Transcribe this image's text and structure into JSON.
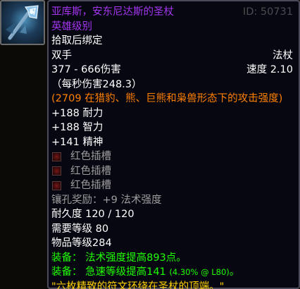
{
  "item": {
    "name": "亚库斯，安东尼达斯的圣杖",
    "id_label": "ID: 50731",
    "quality": "英雄级别",
    "binding": "拾取后绑定",
    "hand": "双手",
    "type": "法杖",
    "damage": "377 - 666伤害",
    "speed": "速度 2.10",
    "dps": "（每秒伤害248.3）",
    "feral_ap": "(2709 在猎豹、熊、巨熊和枭兽形态下的攻击强度)",
    "stats": [
      "+188 耐力",
      "+188 智力",
      "+141 精神"
    ],
    "sockets": [
      "红色插槽",
      "红色插槽",
      "红色插槽"
    ],
    "socket_bonus": "镶孔奖励：+9 法术强度",
    "durability": "耐久度 120 / 120",
    "required_level": "需要等级 80",
    "item_level": "物品等级284",
    "equip_1": "装备： 法术强度提高893点。",
    "equip_2_main": "装备： 急速等级提高141",
    "equip_2_detail": "(4.30% @ L80)",
    "equip_2_tail": "。",
    "flavor": "\"六枚精致的符文环绕在圣杖的顶端。\""
  },
  "icons": {
    "item_icon": "staff-icon",
    "socket_icon": "red-socket-icon"
  },
  "colors": {
    "epic": "#a335ee",
    "uncommon_green": "#1eff00",
    "flavor_gold": "#ffd100",
    "feral_orange": "#ff8000",
    "disabled_gray": "#9d9d9d",
    "white": "#ffffff"
  }
}
